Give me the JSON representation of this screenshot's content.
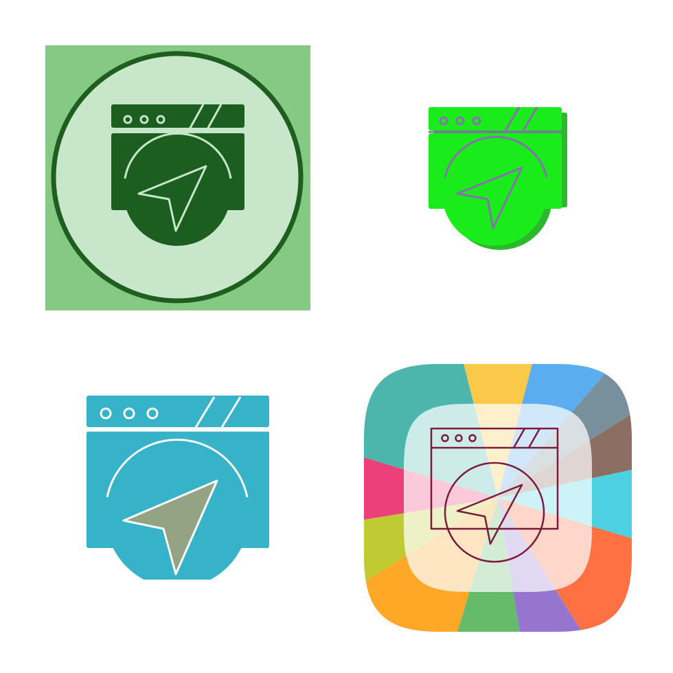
{
  "icon_set": {
    "subject": "browser-navigation-icon",
    "variants": [
      {
        "style": "green-circle-glyph",
        "colors": {
          "background": "#85c985",
          "circle": "#c8e6c9",
          "ring": "#1e5e1e",
          "glyph": "#1b5e20",
          "pointer_outline": "#c8e6c9"
        }
      },
      {
        "style": "bright-green-offset-glyph",
        "colors": {
          "fill": "#1aeb1a",
          "shadow": "#2cb82c",
          "line": "#8a6fb0"
        }
      },
      {
        "style": "teal-flat",
        "colors": {
          "fill": "#36b3c8",
          "pointer": "#94a384",
          "line": "#ffffff"
        }
      },
      {
        "style": "rainbow-tile-outline",
        "colors": {
          "segments": [
            "#fbc94a",
            "#5aaef0",
            "#78909c",
            "#8d6e63",
            "#4dd0e1",
            "#ff7043",
            "#9575cd",
            "#66bb6a",
            "#ffa726",
            "#c0ca33",
            "#ec407a",
            "#4db6ac"
          ],
          "overlay": "#ffffff",
          "line": "#7b1a3a"
        }
      }
    ]
  }
}
